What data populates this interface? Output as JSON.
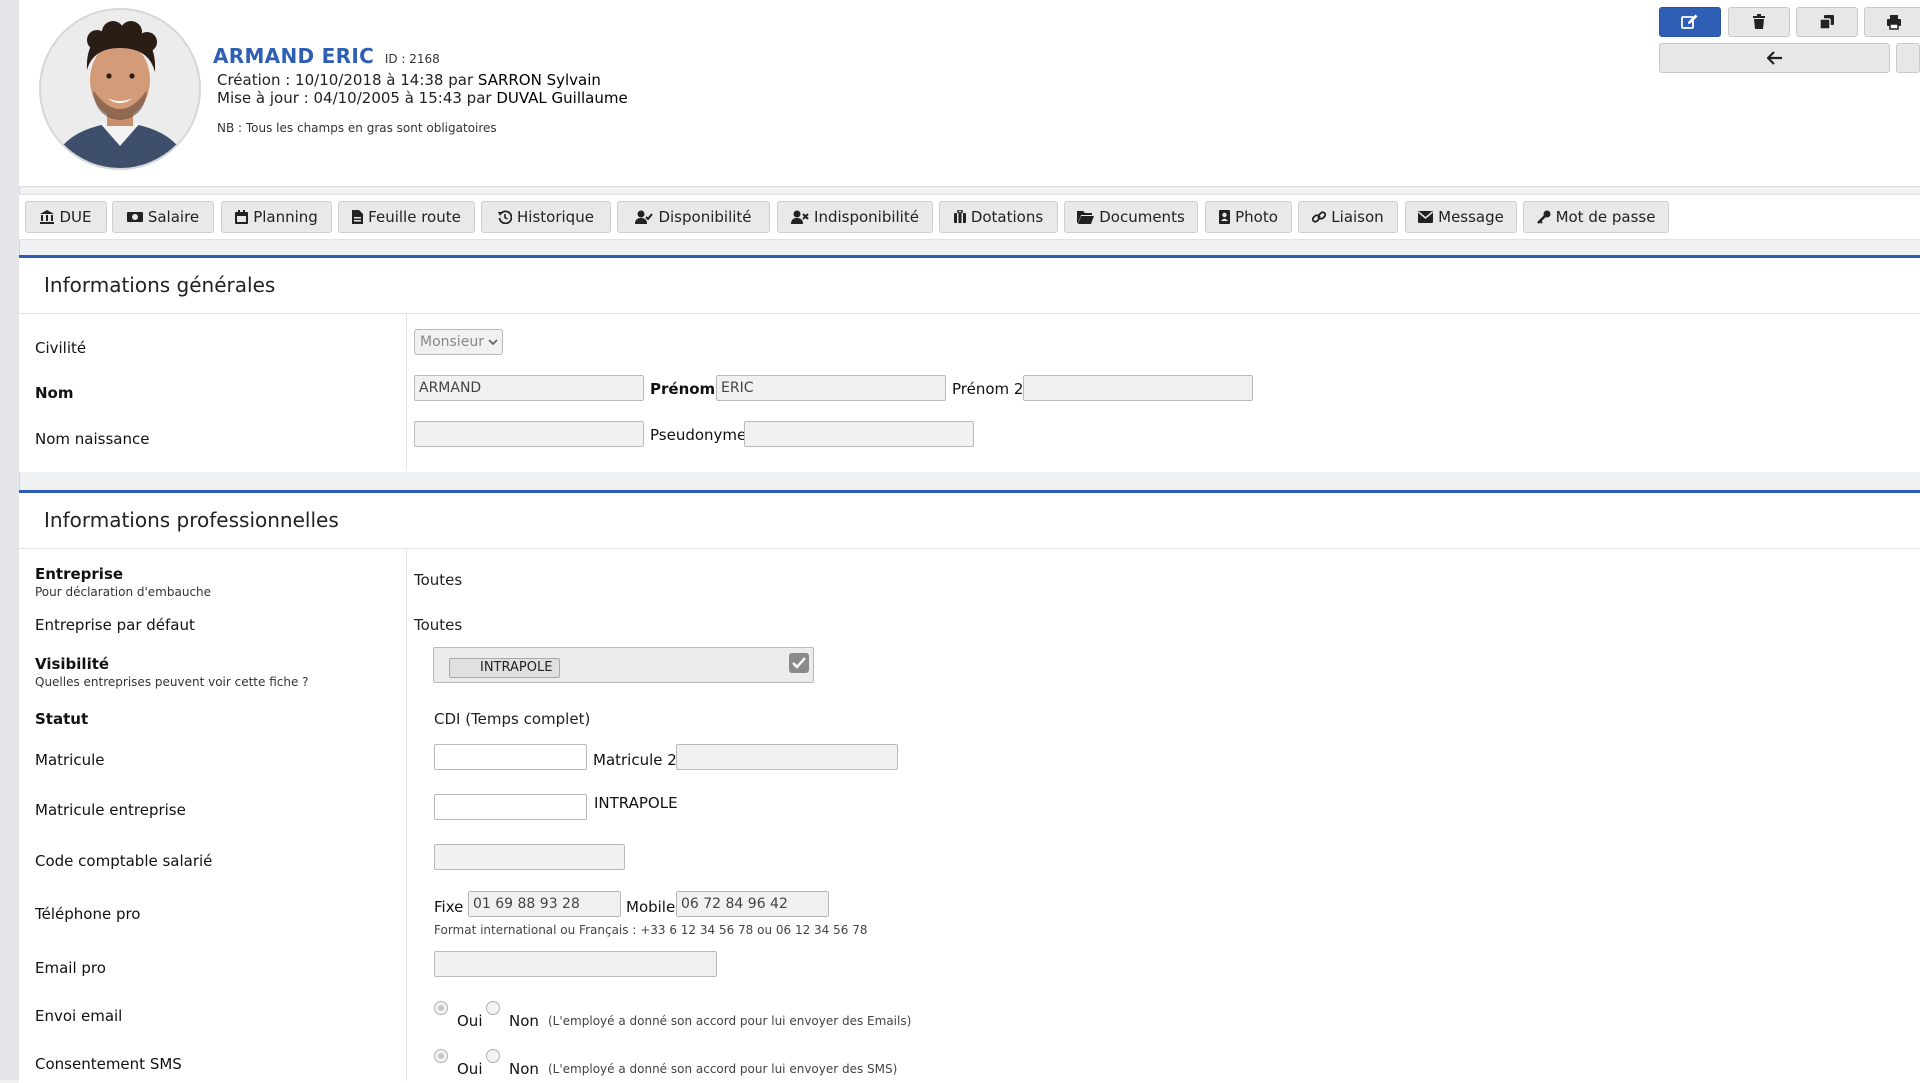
{
  "profile": {
    "name": "ARMAND ERIC",
    "id_label": "ID : 2168",
    "creation_prefix": "Création : 10/10/2018 à 14:38 par ",
    "creation_by": "SARRON Sylvain",
    "update_prefix": "Mise à jour : 04/10/2005 à 15:43 par ",
    "update_by": "DUVAL Guillaume",
    "note": "NB : Tous les champs en gras sont obligatoires"
  },
  "actions": [
    {
      "icon": "edit-icon"
    },
    {
      "icon": "trash-icon"
    },
    {
      "icon": "copy-icon"
    },
    {
      "icon": "print-icon"
    },
    {
      "icon": "arrow-left-icon"
    }
  ],
  "tabs": [
    {
      "label": "DUE",
      "icon": "bank-icon"
    },
    {
      "label": "Salaire",
      "icon": "money-icon"
    },
    {
      "label": "Planning",
      "icon": "calendar-icon"
    },
    {
      "label": "Feuille route",
      "icon": "file-icon"
    },
    {
      "label": "Historique",
      "icon": "history-icon"
    },
    {
      "label": "Disponibilité",
      "icon": "user-check-icon"
    },
    {
      "label": "Indisponibilité",
      "icon": "user-times-icon"
    },
    {
      "label": "Dotations",
      "icon": "suitcase-icon"
    },
    {
      "label": "Documents",
      "icon": "folder-icon"
    },
    {
      "label": "Photo",
      "icon": "portrait-icon"
    },
    {
      "label": "Liaison",
      "icon": "link-icon"
    },
    {
      "label": "Message",
      "icon": "envelope-icon"
    },
    {
      "label": "Mot de passe",
      "icon": "key-icon"
    }
  ],
  "general": {
    "title": "Informations générales",
    "civilite_label": "Civilité",
    "civilite_value": "Monsieur",
    "nom_label": "Nom",
    "nom_value": "ARMAND",
    "prenom_label": "Prénom",
    "prenom_value": "ERIC",
    "prenom2_label": "Prénom 2",
    "prenom2_value": "",
    "nom_naissance_label": "Nom naissance",
    "nom_naissance_value": "",
    "pseudonyme_label": "Pseudonyme",
    "pseudonyme_value": ""
  },
  "pro": {
    "title": "Informations professionnelles",
    "entreprise_label": "Entreprise",
    "entreprise_sub": "Pour déclaration d'embauche",
    "entreprise_value": "Toutes",
    "entreprise_defaut_label": "Entreprise par défaut",
    "entreprise_defaut_value": "Toutes",
    "visibilite_label": "Visibilité",
    "visibilite_sub": "Quelles entreprises peuvent voir cette fiche ?",
    "visibilite_chip": "INTRAPOLE",
    "statut_label": "Statut",
    "statut_value": "CDI (Temps complet)",
    "matricule_label": "Matricule",
    "matricule_value": "",
    "matricule2_label": "Matricule 2",
    "matricule2_value": "",
    "matricule_entreprise_label": "Matricule entreprise",
    "matricule_entreprise_value": "",
    "matricule_entreprise_suffix": "INTRAPOLE",
    "code_comptable_label": "Code comptable salarié",
    "code_comptable_value": "",
    "telephone_label": "Téléphone pro",
    "fixe_label": "Fixe",
    "fixe_value": "01 69 88 93 28",
    "mobile_label": "Mobile",
    "mobile_value": "06 72 84 96 42",
    "telephone_hint": "Format international ou Français : +33 6 12 34 56 78 ou 06 12 34 56 78",
    "email_label": "Email pro",
    "email_value": "",
    "envoi_email_label": "Envoi email",
    "sms_label": "Consentement SMS",
    "oui_label": "Oui",
    "non_label": "Non",
    "email_consent_hint": "(L'employé a donné son accord pour lui envoyer des Emails)",
    "sms_consent_hint": "(L'employé a donné son accord pour lui envoyer des SMS)"
  }
}
